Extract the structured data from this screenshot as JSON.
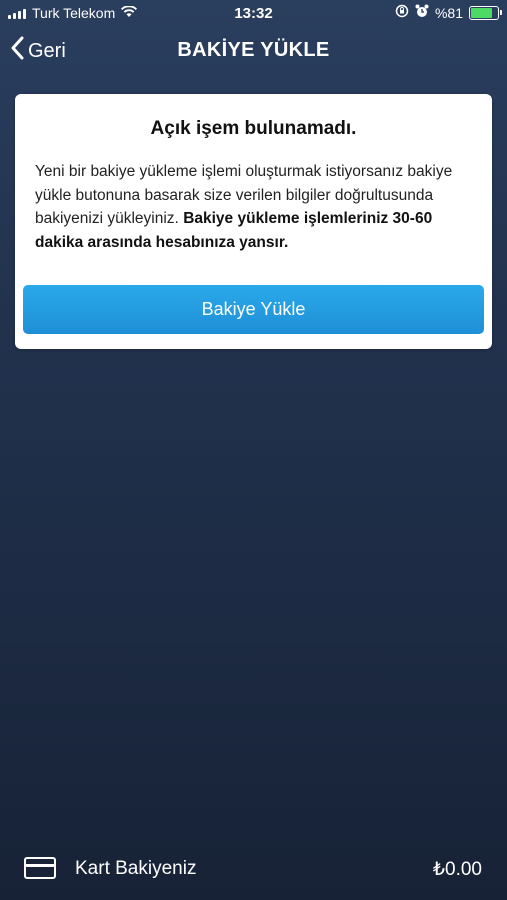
{
  "status_bar": {
    "carrier": "Turk Telekom",
    "time": "13:32",
    "battery_percent": "%81",
    "battery_level": 0.81,
    "icons": [
      "signal-icon",
      "wifi-icon",
      "rotation-lock-icon",
      "alarm-icon",
      "battery-icon"
    ]
  },
  "nav": {
    "back_label": "Geri",
    "title": "BAKİYE YÜKLE"
  },
  "card": {
    "title": "Açık işem bulunamadı.",
    "message": "Yeni bir bakiye yükleme işlemi oluşturmak istiyorsanız bakiye yükle butonuna basarak size verilen bilgiler doğrultusunda bakiyenizi yükleyiniz. ",
    "message_bold": "Bakiye yükleme işlemleriniz 30-60 dakika arasında hesabınıza yansır.",
    "button_label": "Bakiye Yükle"
  },
  "footer": {
    "label": "Kart Bakiyeniz",
    "amount": "₺0.00"
  },
  "colors": {
    "background_top": "#2a3e5e",
    "background_bottom": "#172236",
    "button": "#2aa9ea",
    "battery": "#4cd964"
  }
}
